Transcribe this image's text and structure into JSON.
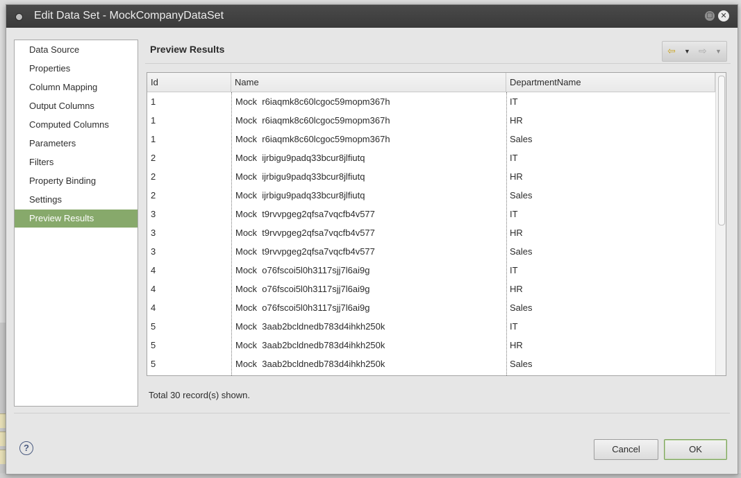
{
  "window": {
    "title": "Edit Data Set - MockCompanyDataSet"
  },
  "nav": {
    "items": [
      {
        "label": "Data Source",
        "active": false
      },
      {
        "label": "Properties",
        "active": false
      },
      {
        "label": "Column Mapping",
        "active": false
      },
      {
        "label": "Output Columns",
        "active": false
      },
      {
        "label": "Computed Columns",
        "active": false
      },
      {
        "label": "Parameters",
        "active": false
      },
      {
        "label": "Filters",
        "active": false
      },
      {
        "label": "Property Binding",
        "active": false
      },
      {
        "label": "Settings",
        "active": false
      },
      {
        "label": "Preview Results",
        "active": true
      }
    ]
  },
  "page": {
    "title": "Preview Results"
  },
  "table": {
    "columns": [
      "Id",
      "Name",
      "DepartmentName"
    ],
    "rows": [
      [
        "1",
        "Mock  r6iaqmk8c60lcgoc59mopm367h",
        "IT"
      ],
      [
        "1",
        "Mock  r6iaqmk8c60lcgoc59mopm367h",
        "HR"
      ],
      [
        "1",
        "Mock  r6iaqmk8c60lcgoc59mopm367h",
        "Sales"
      ],
      [
        "2",
        "Mock  ijrbigu9padq33bcur8jlfiutq",
        "IT"
      ],
      [
        "2",
        "Mock  ijrbigu9padq33bcur8jlfiutq",
        "HR"
      ],
      [
        "2",
        "Mock  ijrbigu9padq33bcur8jlfiutq",
        "Sales"
      ],
      [
        "3",
        "Mock  t9rvvpgeg2qfsa7vqcfb4v577",
        "IT"
      ],
      [
        "3",
        "Mock  t9rvvpgeg2qfsa7vqcfb4v577",
        "HR"
      ],
      [
        "3",
        "Mock  t9rvvpgeg2qfsa7vqcfb4v577",
        "Sales"
      ],
      [
        "4",
        "Mock  o76fscoi5l0h3117sjj7l6ai9g",
        "IT"
      ],
      [
        "4",
        "Mock  o76fscoi5l0h3117sjj7l6ai9g",
        "HR"
      ],
      [
        "4",
        "Mock  o76fscoi5l0h3117sjj7l6ai9g",
        "Sales"
      ],
      [
        "5",
        "Mock  3aab2bcldnedb783d4ihkh250k",
        "IT"
      ],
      [
        "5",
        "Mock  3aab2bcldnedb783d4ihkh250k",
        "HR"
      ],
      [
        "5",
        "Mock  3aab2bcldnedb783d4ihkh250k",
        "Sales"
      ]
    ]
  },
  "status": {
    "total": "Total 30 record(s) shown."
  },
  "buttons": {
    "cancel": "Cancel",
    "ok": "OK",
    "help": "?"
  },
  "icons": {
    "back": "back-arrow-icon",
    "forward": "forward-arrow-icon"
  }
}
